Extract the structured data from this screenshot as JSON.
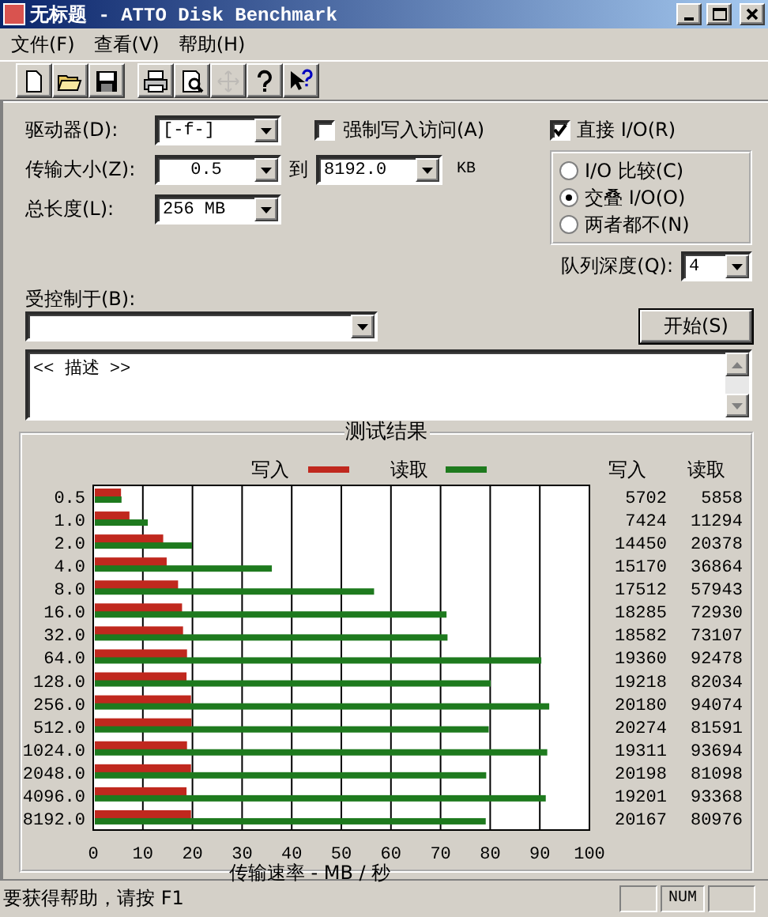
{
  "window": {
    "title": "无标题 - ATTO Disk Benchmark"
  },
  "menu": [
    "文件(F)",
    "查看(V)",
    "帮助(H)"
  ],
  "toolbar": [
    {
      "kind": "new",
      "disabled": false
    },
    {
      "kind": "open",
      "disabled": false
    },
    {
      "kind": "save",
      "disabled": false
    },
    {
      "kind": "print",
      "disabled": false
    },
    {
      "kind": "preview",
      "disabled": false
    },
    {
      "kind": "move",
      "disabled": true
    },
    {
      "kind": "help",
      "disabled": false
    },
    {
      "kind": "context_help",
      "disabled": false
    }
  ],
  "form": {
    "drive": {
      "label": "驱动器(D):",
      "value": "[-f-]"
    },
    "force_write": {
      "label": "强制写入访问(A)",
      "checked": false
    },
    "direct_io": {
      "label": "直接 I/O(R)",
      "checked": true
    },
    "transfer_size": {
      "label": "传输大小(Z):",
      "from": "0.5",
      "to_label": "到",
      "to": "8192.0",
      "unit": "KB"
    },
    "total_length": {
      "label": "总长度(L):",
      "value": "256 MB"
    },
    "io_mode": [
      {
        "label": "I/O 比较(C)",
        "selected": false
      },
      {
        "label": "交叠 I/O(O)",
        "selected": true
      },
      {
        "label": "两者都不(N)",
        "selected": false
      }
    ],
    "queue_depth": {
      "label": "队列深度(Q):",
      "value": "4"
    },
    "controlled_by": {
      "label": "受控制于(B):"
    },
    "start_button": "开始(S)",
    "description": "<< 描述 >>"
  },
  "results": {
    "title": "测试结果",
    "columns": [
      "写入",
      "读取"
    ],
    "rows": [
      {
        "write": "5702",
        "read": "5858"
      },
      {
        "write": "7424",
        "read": "11294"
      },
      {
        "write": "14450",
        "read": "20378"
      },
      {
        "write": "15170",
        "read": "36864"
      },
      {
        "write": "17512",
        "read": "57943"
      },
      {
        "write": "18285",
        "read": "72930"
      },
      {
        "write": "18582",
        "read": "73107"
      },
      {
        "write": "19360",
        "read": "92478"
      },
      {
        "write": "19218",
        "read": "82034"
      },
      {
        "write": "20180",
        "read": "94074"
      },
      {
        "write": "20274",
        "read": "81591"
      },
      {
        "write": "19311",
        "read": "93694"
      },
      {
        "write": "20198",
        "read": "81098"
      },
      {
        "write": "19201",
        "read": "93368"
      },
      {
        "write": "20167",
        "read": "80976"
      }
    ],
    "chart_data": {
      "type": "bar",
      "orientation": "horizontal",
      "xlabel": "传输速率 - MB / 秒",
      "categories": [
        "0.5",
        "1.0",
        "2.0",
        "4.0",
        "8.0",
        "16.0",
        "32.0",
        "64.0",
        "128.0",
        "256.0",
        "512.0",
        "1024.0",
        "2048.0",
        "4096.0",
        "8192.0"
      ],
      "series": [
        {
          "name": "写入",
          "color": "#c0281e",
          "values": [
            5.6,
            7.3,
            14.1,
            14.8,
            17.1,
            17.9,
            18.1,
            18.9,
            18.8,
            19.7,
            19.8,
            18.9,
            19.7,
            18.8,
            19.7
          ]
        },
        {
          "name": "读取",
          "color": "#1e7a1e",
          "values": [
            5.7,
            11.0,
            19.9,
            36.0,
            56.6,
            71.2,
            71.4,
            90.3,
            80.1,
            91.9,
            79.7,
            91.5,
            79.2,
            91.2,
            79.1
          ]
        }
      ],
      "grid": true,
      "legend": true,
      "xlim": [
        0,
        100
      ],
      "xticks": [
        0,
        10,
        20,
        30,
        40,
        50,
        60,
        70,
        80,
        90,
        100
      ]
    }
  },
  "status_bar": {
    "text": "要获得帮助，请按 F1",
    "indicators": [
      "NUM"
    ]
  }
}
